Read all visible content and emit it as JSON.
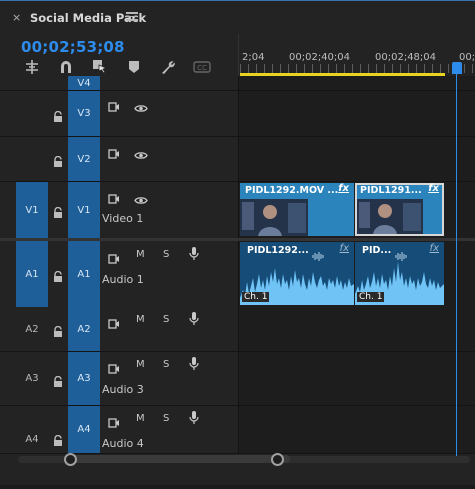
{
  "sequence": {
    "close_glyph": "×",
    "title": "Social Media Pack",
    "menu_icon": "hamburger-icon"
  },
  "timecode": "00;02;53;08",
  "toolbar": [
    "snap-in-timeline-icon",
    "linked-selection-icon",
    "add-marker-icon",
    "marker-icon",
    "wrench-icon",
    "captions-icon"
  ],
  "ruler": {
    "labels": [
      "2;04",
      "00;02;40;04",
      "00;02;48;04",
      "00;0"
    ]
  },
  "video_tracks": [
    {
      "target": "V4",
      "source": "",
      "name": ""
    },
    {
      "target": "V3",
      "source": "",
      "name": ""
    },
    {
      "target": "V2",
      "source": "",
      "name": ""
    },
    {
      "target": "V1",
      "source": "V1",
      "name": "Video 1"
    }
  ],
  "audio_tracks": [
    {
      "target": "A1",
      "source": "A1",
      "name": "Audio 1",
      "mute": "M",
      "solo": "S"
    },
    {
      "target": "A2",
      "source": "A2",
      "name": "",
      "mute": "M",
      "solo": "S"
    },
    {
      "target": "A3",
      "source": "A3",
      "name": "Audio 3",
      "mute": "M",
      "solo": "S"
    },
    {
      "target": "A4",
      "source": "A4",
      "name": "Audio 4",
      "mute": "M",
      "solo": "S"
    }
  ],
  "clips": {
    "video": [
      {
        "label": "PIDL1292.MOV ...",
        "fx": "fx"
      },
      {
        "label": "PIDL1291...",
        "fx": "fx"
      }
    ],
    "audio": [
      {
        "label": "PIDL1292...",
        "fx": "fx",
        "channel": "Ch. 1"
      },
      {
        "label": "PID...",
        "fx": "fx",
        "channel": "Ch. 1"
      }
    ]
  },
  "colors": {
    "accent": "#2d8ceb",
    "video_clip": "#2c84bd",
    "audio_clip": "#154c78",
    "waveform": "#6fc3f5",
    "work_area": "#e8d31e"
  }
}
